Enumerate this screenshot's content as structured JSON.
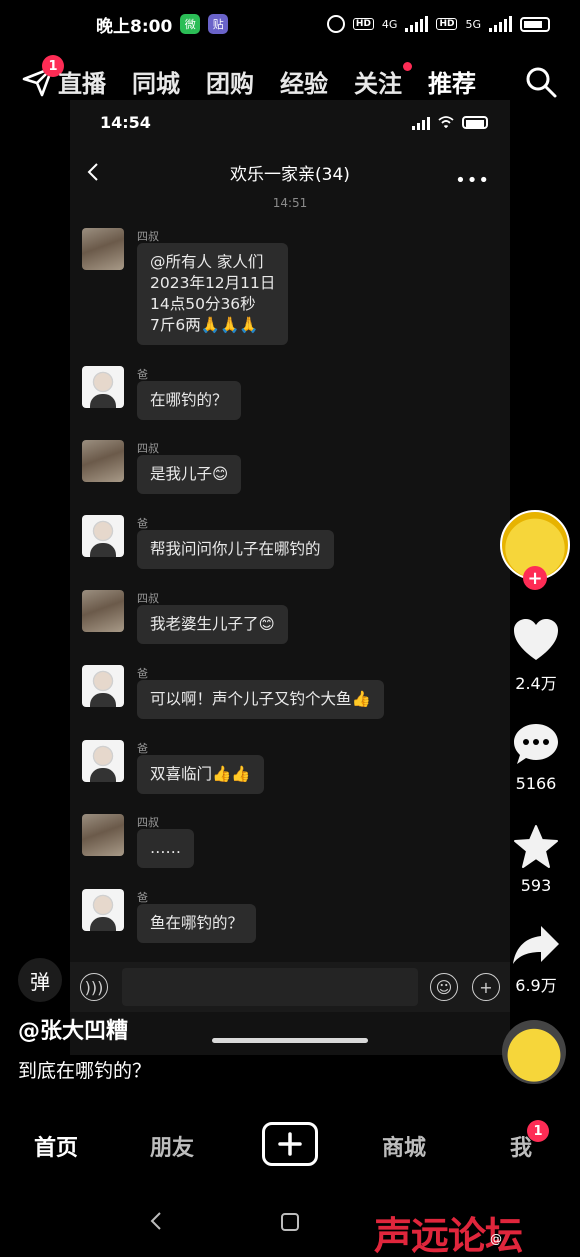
{
  "status_bar": {
    "time": "晚上8:00",
    "app_wechat": "微",
    "app_tie": "贴",
    "hd1": "HD",
    "net1": "4G",
    "hd2": "HD",
    "net2": "5G"
  },
  "top_nav": {
    "notification_count": "1",
    "tabs": [
      "直播",
      "同城",
      "团购",
      "经验",
      "关注",
      "推荐"
    ],
    "active_tab": "推荐"
  },
  "chat": {
    "status_time": "14:54",
    "title": "欢乐一家亲(34)",
    "more": "•••",
    "timestamp": "14:51",
    "messages": [
      {
        "sender": "四叔",
        "text": "@所有人 家人们\n2023年12月11日\n14点50分36秒\n7斤6两🙏🙏🙏"
      },
      {
        "sender": "爸",
        "text": "在哪钓的？"
      },
      {
        "sender": "四叔",
        "text": "是我儿子😊"
      },
      {
        "sender": "爸",
        "text": "帮我问问你儿子在哪钓的"
      },
      {
        "sender": "四叔",
        "text": "我老婆生儿子了😊"
      },
      {
        "sender": "爸",
        "text": "可以啊！声个儿子又钓个大鱼👍"
      },
      {
        "sender": "爸",
        "text": "双喜临门👍👍"
      },
      {
        "sender": "四叔",
        "text": "……"
      },
      {
        "sender": "爸",
        "text": "鱼在哪钓的？"
      }
    ]
  },
  "actions": {
    "likes": "2.4万",
    "comments": "5166",
    "favorites": "593",
    "shares": "6.9万"
  },
  "video": {
    "danmu_label": "弹",
    "author": "@张大凹糟",
    "caption": "到底在哪钓的？"
  },
  "bottom_nav": {
    "home": "首页",
    "friends": "朋友",
    "mall": "商城",
    "me": "我",
    "me_badge": "1"
  },
  "watermark": {
    "text": "声远论坛",
    "sub": "@"
  }
}
